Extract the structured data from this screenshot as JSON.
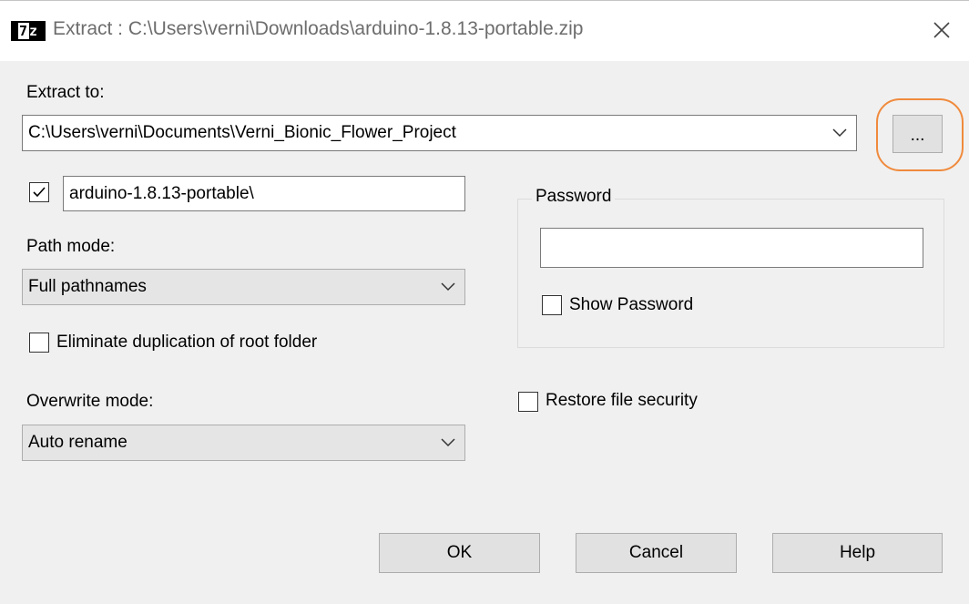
{
  "window": {
    "title": "Extract : C:\\Users\\verni\\Downloads\\arduino-1.8.13-portable.zip",
    "icon_text_left": "7",
    "icon_text_right": "z"
  },
  "extract_to": {
    "label": "Extract to:",
    "value": "C:\\Users\\verni\\Documents\\Verni_Bionic_Flower_Project",
    "browse_label": "..."
  },
  "subfolder": {
    "checked": true,
    "value": "arduino-1.8.13-portable\\"
  },
  "path_mode": {
    "label": "Path mode:",
    "value": "Full pathnames"
  },
  "eliminate_duplication": {
    "label": "Eliminate duplication of root folder",
    "checked": false
  },
  "overwrite_mode": {
    "label": "Overwrite mode:",
    "value": "Auto rename"
  },
  "password": {
    "group_label": "Password",
    "value": "",
    "show_password_label": "Show Password",
    "show_password_checked": false
  },
  "restore_security": {
    "label": "Restore file security",
    "checked": false
  },
  "buttons": {
    "ok": "OK",
    "cancel": "Cancel",
    "help": "Help"
  },
  "colors": {
    "highlight": "#f08a3c",
    "background": "#f0f0f0",
    "button": "#e1e1e1"
  }
}
